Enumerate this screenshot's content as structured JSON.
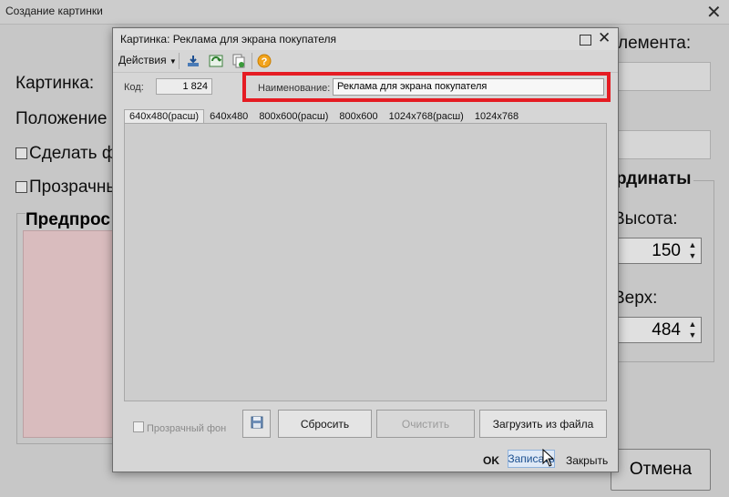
{
  "background_window": {
    "title": "Создание картинки",
    "label_picture": "Картинка:",
    "label_position": "Положение",
    "checkbox_make": "Сделать ф",
    "checkbox_transparent": "Прозрачны",
    "preview_group": "Предпрос",
    "label_element": "лемента:",
    "coords_group": "рдинаты",
    "label_height": "Высота:",
    "height_value": "150",
    "label_top": "Верх:",
    "top_value": "484",
    "cancel_button": "Отмена",
    "preview_color": "#f7d7d9"
  },
  "dialog": {
    "title": "Картинка: Реклама для экрана покупателя",
    "toolbar": {
      "actions_menu": "Действия"
    },
    "code_label": "Код:",
    "code_value": "1 824",
    "name_label": "Наименование:",
    "name_value": "Реклама для экрана покупателя",
    "tabs": [
      {
        "label": "640x480(расш)",
        "active": true
      },
      {
        "label": "640x480",
        "active": false
      },
      {
        "label": "800x600(расш)",
        "active": false
      },
      {
        "label": "800x600",
        "active": false
      },
      {
        "label": "1024x768(расш)",
        "active": false
      },
      {
        "label": "1024x768",
        "active": false
      }
    ],
    "transparent_bg_label": "Прозрачный фон",
    "buttons": {
      "reset": "Сбросить",
      "clear": "Очистить",
      "load": "Загрузить из файла",
      "ok": "OK",
      "write": "Записать",
      "close": "Закрыть"
    },
    "highlight_color": "#e51c23"
  }
}
